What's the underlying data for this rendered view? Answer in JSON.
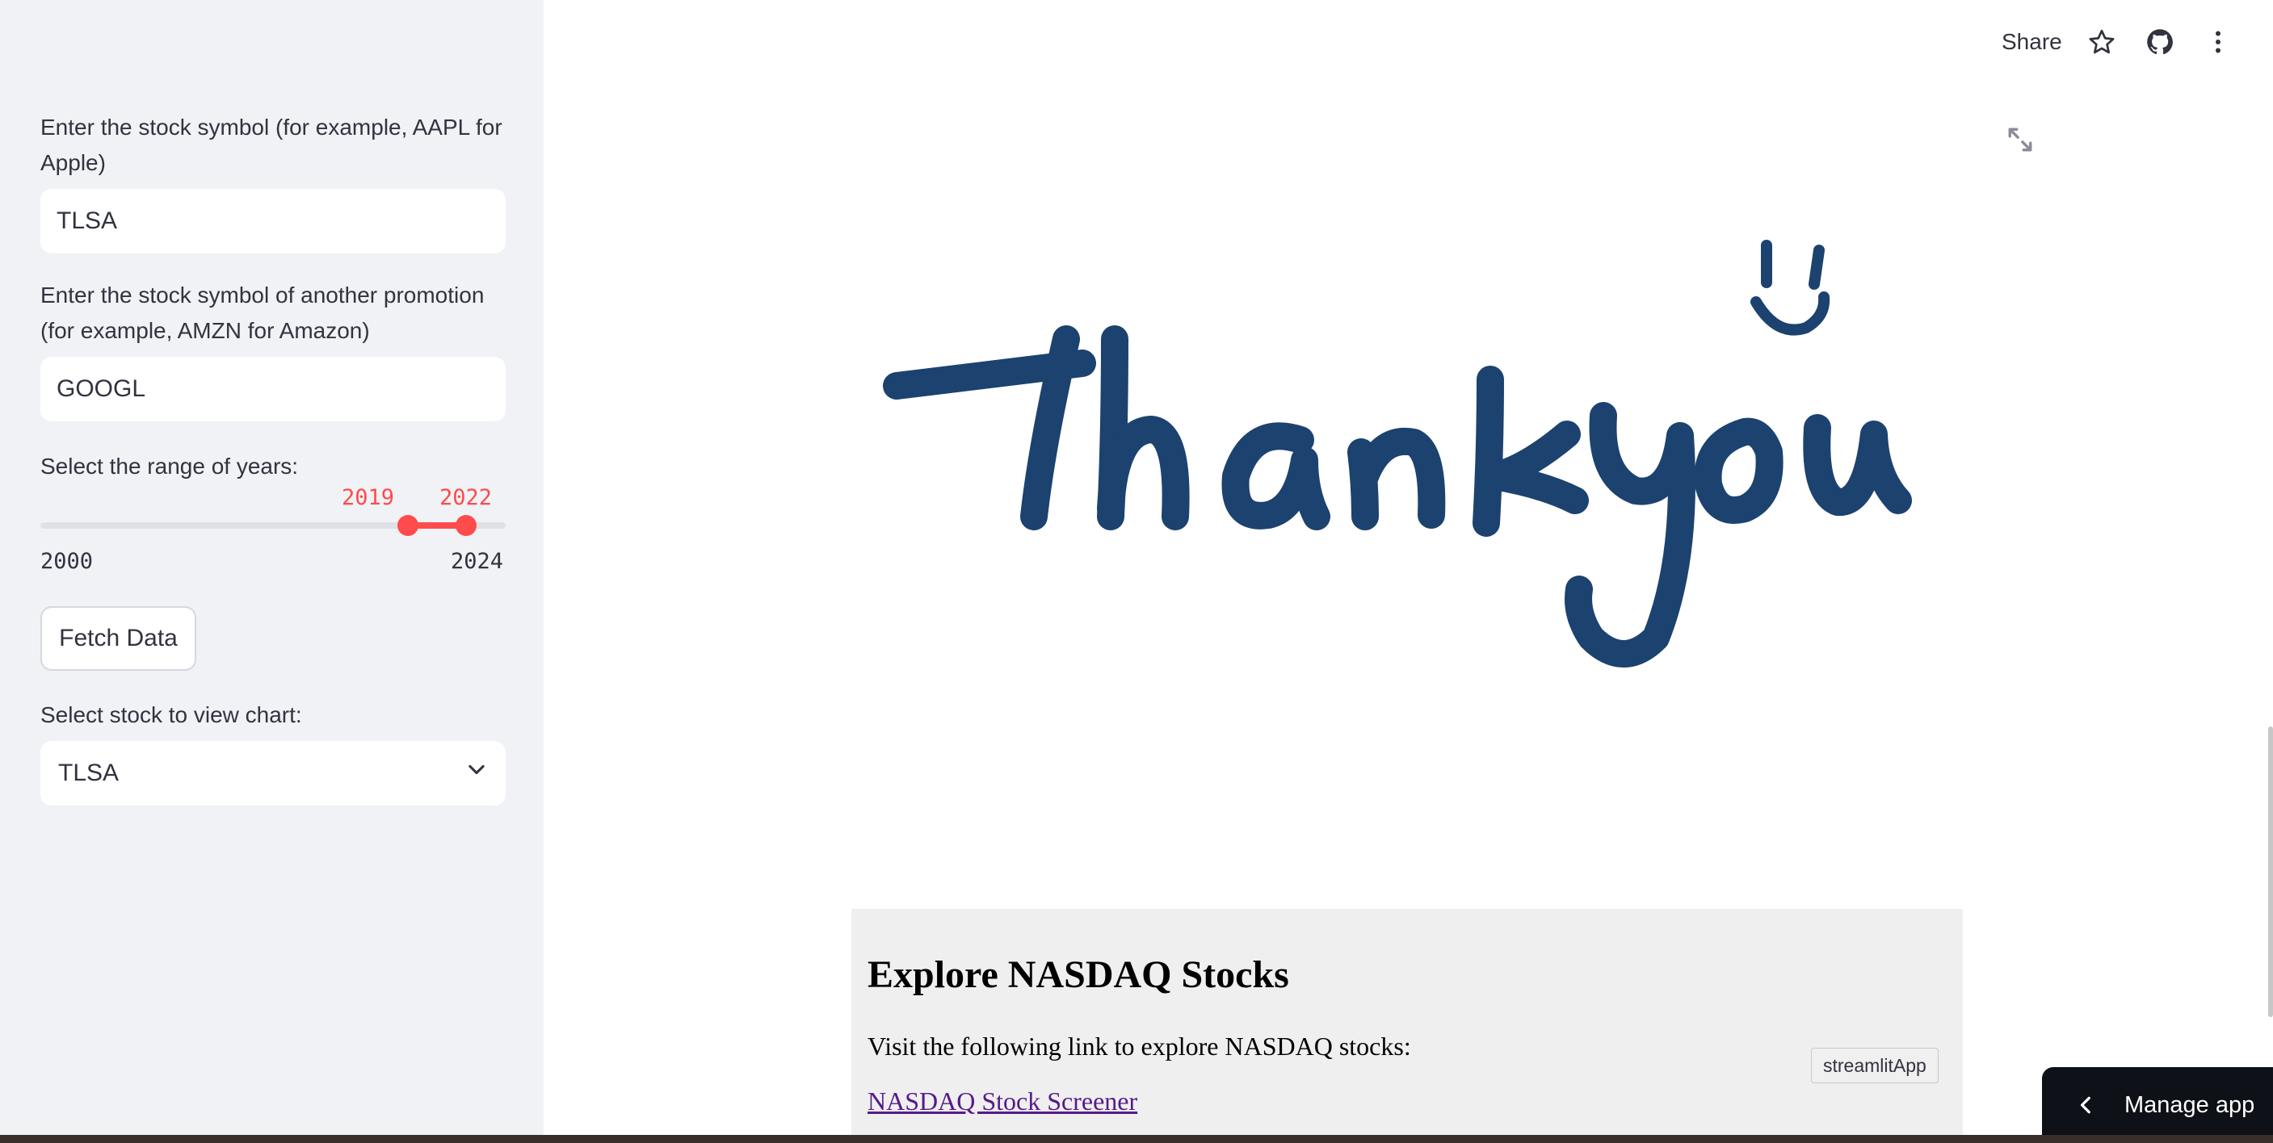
{
  "sidebar": {
    "symbol1_label": "Enter the stock symbol (for example, AAPL for Apple)",
    "symbol1_value": "TLSA",
    "symbol2_label": "Enter the stock symbol of another promotion (for example, AMZN for Amazon)",
    "symbol2_value": "GOOGL",
    "range_label": "Select the range of years:",
    "range_min": "2000",
    "range_max": "2024",
    "range_low": "2019",
    "range_high": "2022",
    "fetch_button": "Fetch Data",
    "chart_select_label": "Select stock to view chart:",
    "chart_select_value": "TLSA"
  },
  "toolbar": {
    "share_label": "Share",
    "icons": [
      "star-icon",
      "github-icon",
      "more-vertical-icon"
    ]
  },
  "main": {
    "image_alt": "Thank you",
    "nasdaq": {
      "title": "Explore NASDAQ Stocks",
      "text": "Visit the following link to explore NASDAQ stocks:",
      "link": "NASDAQ Stock Screener"
    },
    "tooltip": "streamlitApp"
  },
  "manage_app": "Manage app",
  "colors": {
    "accent": "#ff4b4b",
    "sidebar_bg": "#f0f2f6",
    "thank_you_ink": "#1c426f"
  }
}
